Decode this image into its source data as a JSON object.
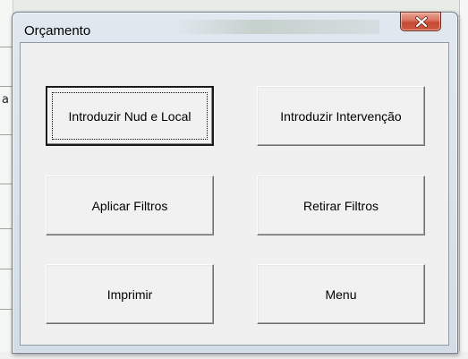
{
  "window": {
    "title": "Orçamento",
    "close_glyph": "×"
  },
  "background": {
    "left_column_glyph": "a"
  },
  "buttons": {
    "introduzir_nud": "Introduzir Nud e Local",
    "introduzir_intervencao": "Introduzir Intervenção",
    "aplicar_filtros": "Aplicar Filtros",
    "retirar_filtros": "Retirar Filtros",
    "imprimir": "Imprimir",
    "menu": "Menu"
  },
  "icons": {
    "close": "close-icon"
  },
  "colors": {
    "close_button": "#c44a33",
    "client_background": "#f0f0f0",
    "title_bar": "#dbe3eb"
  }
}
